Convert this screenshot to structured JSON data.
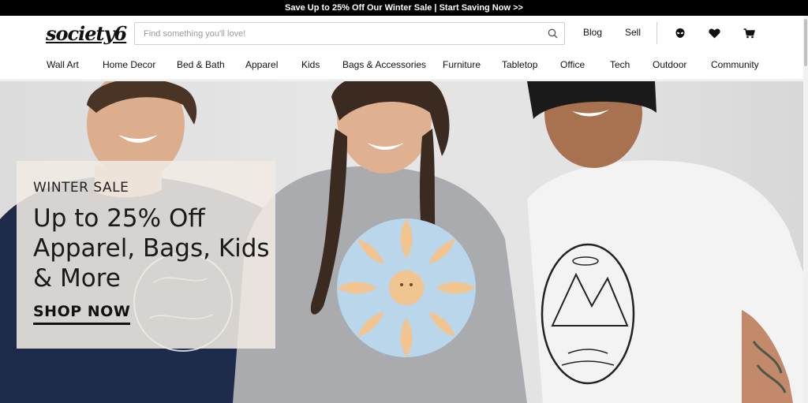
{
  "promo_bar": {
    "text": "Save Up to 25% Off Our Winter Sale | Start Saving Now >>"
  },
  "header": {
    "logo": "society6",
    "search_placeholder": "Find something you'll love!",
    "blog_label": "Blog",
    "sell_label": "Sell",
    "icons": [
      "alien-account-icon",
      "heart-icon",
      "cart-icon"
    ]
  },
  "nav": {
    "items": [
      {
        "label": "Wall Art"
      },
      {
        "label": "Home Decor"
      },
      {
        "label": "Bed & Bath"
      },
      {
        "label": "Apparel"
      },
      {
        "label": "Kids"
      },
      {
        "label": "Bags & Accessories"
      },
      {
        "label": "Furniture"
      },
      {
        "label": "Tabletop"
      },
      {
        "label": "Office"
      },
      {
        "label": "Tech"
      },
      {
        "label": "Outdoor"
      },
      {
        "label": "Community"
      }
    ]
  },
  "hero": {
    "kicker": "WINTER SALE",
    "headline": "Up to 25% Off Apparel, Bags, Kids & More",
    "cta": "SHOP NOW",
    "colors": {
      "navy_tee": "#1e2a4a",
      "gray_sweatshirt": "#a9abaf",
      "white_tee": "#f3f3f3",
      "sun_orange": "#f2c48f",
      "sun_blue": "#b9d6ea"
    }
  }
}
